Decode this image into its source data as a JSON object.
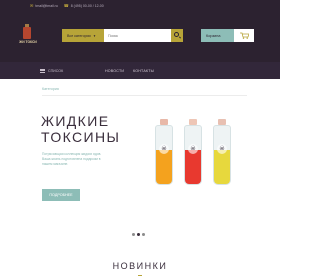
{
  "header": {
    "email": "tmail@tmail.ru",
    "phone": "8 (495) 00-00 / 12-00",
    "logo_text": "ЖИ ТОКСИ",
    "category_button": "Все категории",
    "search_placeholder": "Поиск",
    "cart_label": "Корзина"
  },
  "nav": {
    "menu_label": "СПИСОК",
    "links": [
      "НОВОСТИ",
      "КОНТАКТЫ"
    ]
  },
  "hero": {
    "breadcrumb": "Категория",
    "title": "ЖИДКИЕ ТОКСИНЫ",
    "description": "Потрясающая коллекция жидких ядов. Ваша жизнь подготовлена подарком в нашем магазине.",
    "button_label": "ПОДРОБНЕЕ",
    "slides": 3,
    "active_slide": 1,
    "bottles": [
      {
        "cork": "#e8b8a8",
        "liquid": "#f4a21e",
        "symbol": "☠"
      },
      {
        "cork": "#eec6b6",
        "liquid": "#e8392f",
        "symbol": "☠"
      },
      {
        "cork": "#e8c0b2",
        "liquid": "#e7d83d",
        "symbol": "☠"
      }
    ]
  },
  "section": {
    "title": "НОВИНКИ"
  },
  "colors": {
    "header_bg": "#2c2230",
    "accent_gold": "#b7a438",
    "accent_teal": "#8dbdb7",
    "title_text": "#3a2e3c"
  }
}
